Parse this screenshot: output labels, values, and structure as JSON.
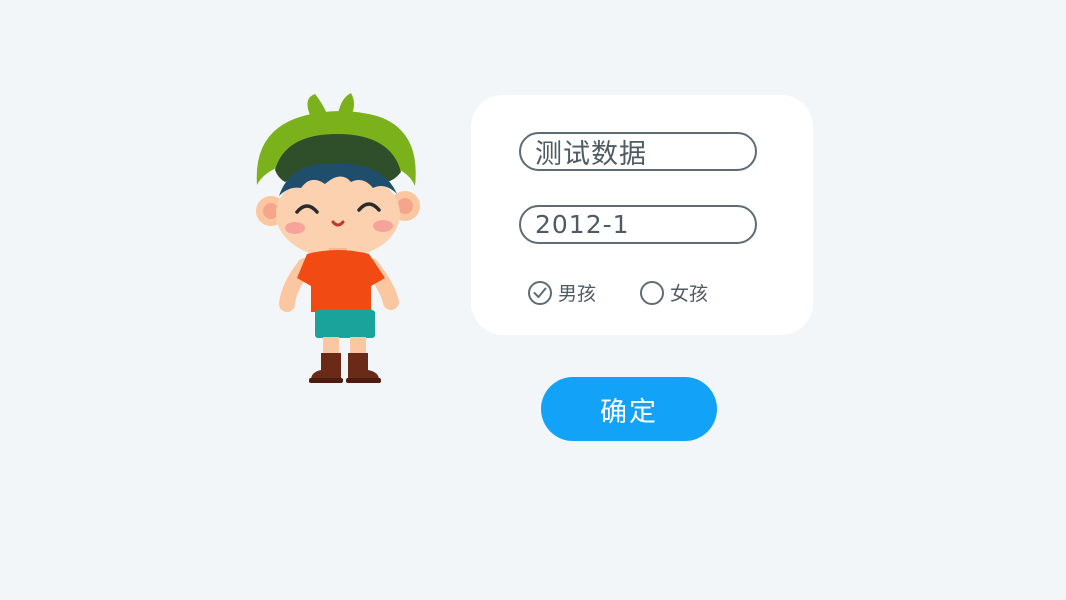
{
  "form": {
    "name_value": "测试数据",
    "birth_value": "2012-1",
    "gender": {
      "options": [
        {
          "label": "男孩",
          "checked": true
        },
        {
          "label": "女孩",
          "checked": false
        }
      ]
    },
    "confirm_label": "确定"
  },
  "icons": {
    "mascot": "boy-character-illustration",
    "checked": "check-icon"
  },
  "colors": {
    "background": "#f2f6f9",
    "card": "#ffffff",
    "border": "#5f6b75",
    "text": "#505a63",
    "primary": "#12a3f8"
  }
}
